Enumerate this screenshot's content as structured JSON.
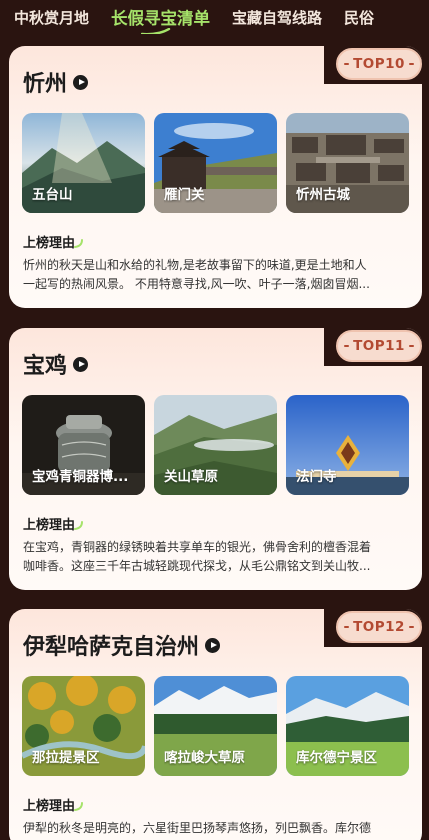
{
  "tabs": [
    {
      "label": "中秋赏月地",
      "active": false
    },
    {
      "label": "长假寻宝清单",
      "active": true
    },
    {
      "label": "宝藏自驾线路",
      "active": false
    },
    {
      "label": "民俗",
      "active": false
    }
  ],
  "colors": {
    "background": "#2a1410",
    "active_tab": "#a6e36a",
    "badge_text": "#b34a32",
    "card_top": "#fde6dc"
  },
  "reason_label": "上榜理由",
  "cards": [
    {
      "title": "忻州",
      "rank": "TOP10",
      "photos": [
        {
          "label": "五台山",
          "icon": "mountain-photo"
        },
        {
          "label": "雁门关",
          "icon": "fortress-photo"
        },
        {
          "label": "忻州古城",
          "icon": "old-town-photo"
        }
      ],
      "reason_lines": [
        "忻州的秋天是山和水给的礼物,是老故事留下的味道,更是土地和人",
        "一起写的热闹风景。 不用特意寻找,风一吹、叶子一落,烟囱冒烟..."
      ]
    },
    {
      "title": "宝鸡",
      "rank": "TOP11",
      "photos": [
        {
          "label": "宝鸡青铜器博...",
          "icon": "bronze-photo"
        },
        {
          "label": "关山草原",
          "icon": "grassland-photo"
        },
        {
          "label": "法门寺",
          "icon": "temple-photo"
        }
      ],
      "reason_lines": [
        "在宝鸡，青铜器的绿锈映着共享单车的银光，佛骨舍利的檀香混着",
        "咖啡香。这座三千年古城轻跳现代探戈，从毛公鼎铭文到关山牧..."
      ]
    },
    {
      "title": "伊犁哈萨克自治州",
      "rank": "TOP12",
      "photos": [
        {
          "label": "那拉提景区",
          "icon": "forest-photo"
        },
        {
          "label": "喀拉峻大草原",
          "icon": "snow-mountain-photo"
        },
        {
          "label": "库尔德宁景区",
          "icon": "valley-photo"
        }
      ],
      "reason_lines": [
        "伊犁的秋冬是明亮的，六星街里巴扬琴声悠扬，列巴飘香。库尔德",
        ""
      ]
    }
  ]
}
